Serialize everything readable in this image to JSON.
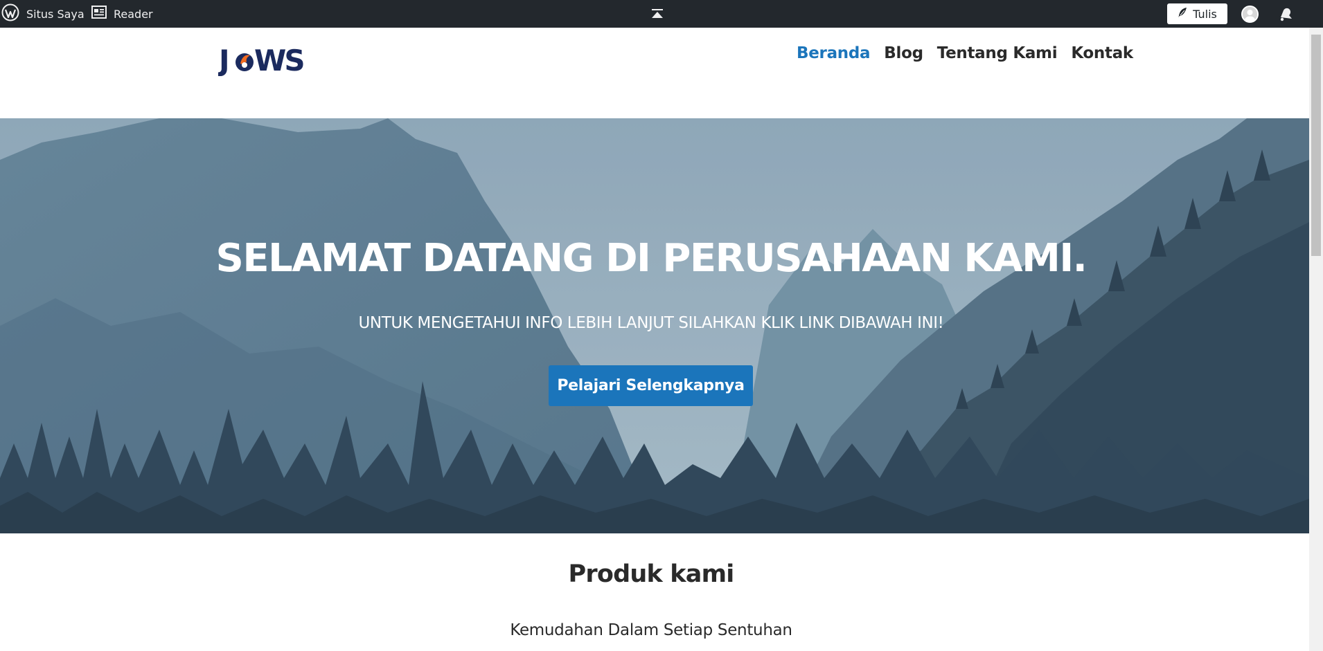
{
  "admin_bar": {
    "my_site_label": "Situs Saya",
    "reader_label": "Reader",
    "write_label": "Tulis"
  },
  "site": {
    "logo_text": "JAWS",
    "nav": [
      {
        "label": "Beranda",
        "active": true
      },
      {
        "label": "Blog",
        "active": false
      },
      {
        "label": "Tentang Kami",
        "active": false
      },
      {
        "label": "Kontak",
        "active": false
      }
    ]
  },
  "hero": {
    "title": "SELAMAT DATANG DI PERUSAHAAN KAMI.",
    "subtitle": "UNTUK MENGETAHUI INFO LEBIH LANJUT SILAHKAN KLIK LINK DIBAWAH INI!",
    "button_label": "Pelajari Selengkapnya"
  },
  "products": {
    "title": "Produk kami",
    "subtitle": "Kemudahan Dalam Setiap Sentuhan"
  },
  "colors": {
    "admin_bar_bg": "#23282d",
    "accent": "#1b75bb",
    "text": "#2a2a2a",
    "logo_navy": "#1b2a5e",
    "logo_orange": "#f26b21"
  },
  "icons": {
    "wp": "wordpress-icon",
    "reader": "reader-icon",
    "center": "collapse-up-icon",
    "write": "feather-icon",
    "avatar": "avatar",
    "notifications": "bell-icon"
  }
}
